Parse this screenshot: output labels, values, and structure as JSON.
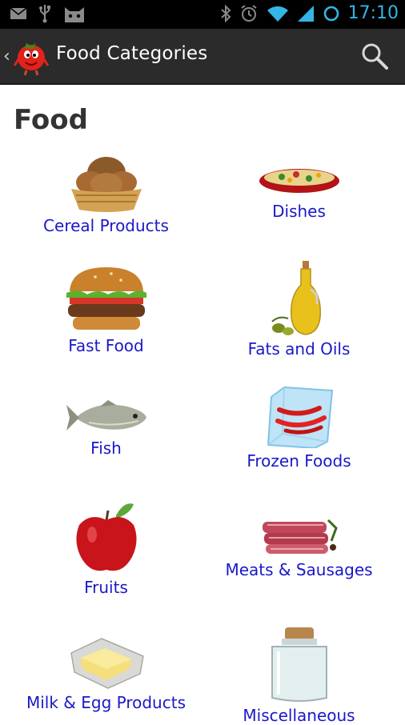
{
  "status_bar": {
    "time": "17:10",
    "icons": [
      "mail-icon",
      "usb-icon",
      "android-cat-icon",
      "bluetooth-icon",
      "alarm-icon",
      "wifi-icon",
      "signal-icon",
      "sync-icon"
    ]
  },
  "action_bar": {
    "title": "Food Categories",
    "up_icon": "chevron-left-icon",
    "app_icon": "tomato-mascot-icon",
    "search_icon": "search-icon"
  },
  "section": {
    "title": "Food"
  },
  "categories": [
    {
      "label": "Cereal Products",
      "icon": "bread-basket-icon"
    },
    {
      "label": "Dishes",
      "icon": "dish-pan-icon"
    },
    {
      "label": "Fast Food",
      "icon": "burger-icon"
    },
    {
      "label": "Fats and Oils",
      "icon": "oil-bottle-icon"
    },
    {
      "label": "Fish",
      "icon": "fish-icon"
    },
    {
      "label": "Frozen Foods",
      "icon": "ice-cube-peppers-icon"
    },
    {
      "label": "Fruits",
      "icon": "apple-icon"
    },
    {
      "label": "Meats & Sausages",
      "icon": "meat-icon"
    },
    {
      "label": "Milk & Egg Products",
      "icon": "butter-icon"
    },
    {
      "label": "Miscellaneous",
      "icon": "jar-icon"
    }
  ]
}
